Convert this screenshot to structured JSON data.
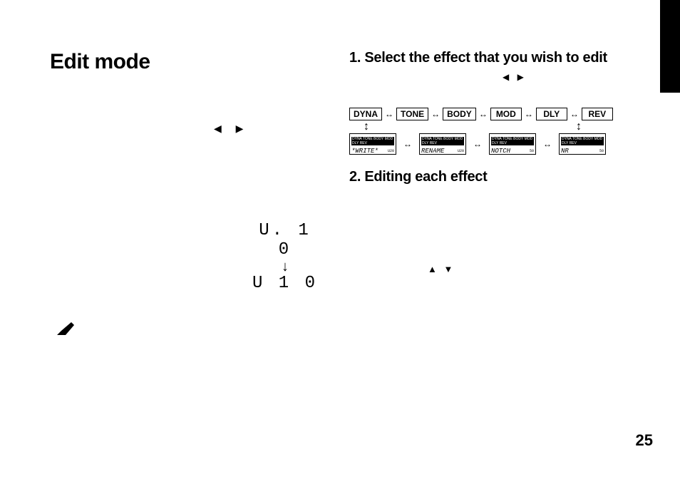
{
  "page_number": "25",
  "left": {
    "title": "Edit mode",
    "arrows_lr": "◀    ▶",
    "lcd_top": "U. 1 0",
    "lcd_arrow": "↓",
    "lcd_bottom": "U  1 0"
  },
  "right": {
    "step1_title": "1. Select the effect that you wish to edit",
    "step1_arrows": "◀ ▶",
    "step2_title": "2. Editing each effect",
    "step2_arrows": "▲ ▼",
    "effects_row": [
      "DYNA",
      "TONE",
      "BODY",
      "MOD",
      "DLY",
      "REV"
    ],
    "connector": "↔",
    "vconnector": "↕",
    "screens": [
      {
        "top": "DYNA TONE BODY MOD DLY REV",
        "main": "*WRITE*",
        "sub": "U20"
      },
      {
        "top": "DYNA TONE BODY MOD DLY REV",
        "main": "RENAME",
        "sub": "U20"
      },
      {
        "top": "DYNA TONE BODY MOD DLY REV",
        "main": "NOTCH",
        "sub": "50",
        "icon": "☾"
      },
      {
        "top": "DYNA TONE BODY MOD DLY REV",
        "main": "NR",
        "sub": "50",
        "icon": "☾"
      }
    ]
  }
}
